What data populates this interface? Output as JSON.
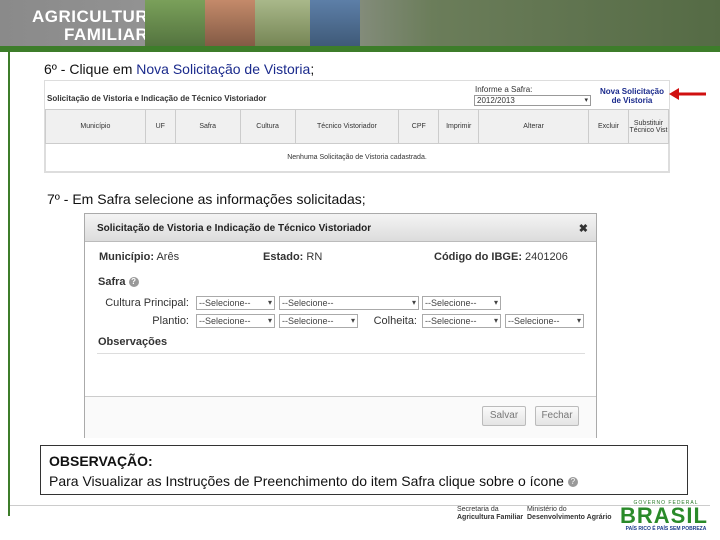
{
  "banner": {
    "line1": "AGRICULTURA",
    "line2": "FAMILIAR"
  },
  "steps": {
    "step6_prefix": "6º - Clique em ",
    "step6_highlight": "Nova Solicitação de Vistoria",
    "step6_suffix": ";",
    "step7": "7º - Em Safra selecione as informações solicitadas;"
  },
  "screen1": {
    "title": "Solicitação de Vistoria e Indicação de Técnico Vistoriador",
    "safra_label": "Informe a Safra:",
    "safra_value": "2012/2013",
    "new_link": "Nova Solicitação de Vistoria",
    "columns": [
      "Município",
      "UF",
      "Safra",
      "Cultura",
      "Técnico Vistoriador",
      "CPF",
      "Imprimir",
      "Alterar",
      "Excluir",
      "Substituir Técnico Vist"
    ],
    "empty_message": "Nenhuma Solicitação de Vistoria cadastrada."
  },
  "dialog": {
    "title": "Solicitação de Vistoria e Indicação de Técnico Vistoriador",
    "close": "✖",
    "municipio_label": "Município:",
    "municipio_value": "Arês",
    "estado_label": "Estado:",
    "estado_value": "RN",
    "ibge_label": "Código do IBGE:",
    "ibge_value": "2401206",
    "safra_section": "Safra",
    "cultura_label": "Cultura Principal:",
    "plantio_label": "Plantio:",
    "colheita_label": "Colheita:",
    "select_placeholder": "--Selecione--",
    "observacoes": "Observações",
    "save": "Salvar",
    "close_btn": "Fechar"
  },
  "note": {
    "title": "OBSERVAÇÃO:",
    "text": "Para Visualizar as Instruções de Preenchimento do item Safra clique sobre o ícone"
  },
  "footer": {
    "sec1": "Secretaria da",
    "sec2": "Agricultura Familiar",
    "min1": "Ministério do",
    "min2": "Desenvolvimento Agrário",
    "gov": "GOVERNO FEDERAL",
    "brasil": "BRASIL",
    "slogan": "PAÍS RICO É PAÍS SEM POBREZA"
  }
}
